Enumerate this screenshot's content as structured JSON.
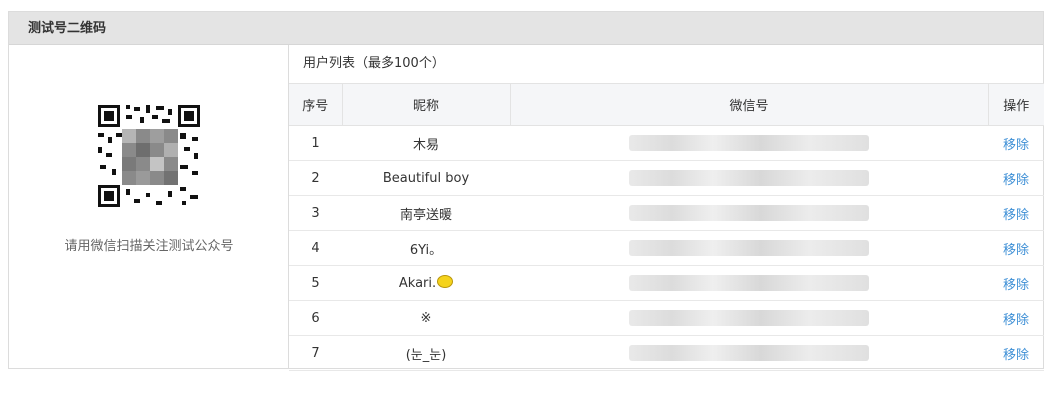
{
  "panel": {
    "title": "测试号二维码"
  },
  "qr": {
    "caption": "请用微信扫描关注测试公众号"
  },
  "users": {
    "title": "用户列表（最多100个）",
    "columns": {
      "no": "序号",
      "nickname": "昵称",
      "wechat_id": "微信号",
      "action": "操作"
    },
    "rows": [
      {
        "no": "1",
        "nickname": "木易",
        "action": "移除"
      },
      {
        "no": "2",
        "nickname": "Beautiful boy",
        "action": "移除"
      },
      {
        "no": "3",
        "nickname": "南亭送暖",
        "action": "移除"
      },
      {
        "no": "4",
        "nickname": "6Yi。",
        "action": "移除"
      },
      {
        "no": "5",
        "nickname": "Akari.",
        "nickname_icon": "lemon-emoji",
        "action": "移除"
      },
      {
        "no": "6",
        "nickname": "※",
        "action": "移除"
      },
      {
        "no": "7",
        "nickname": "(눈_눈)",
        "action": "移除"
      }
    ]
  },
  "colors": {
    "link": "#3d8fd6",
    "header_bg": "#e4e4e4",
    "table_header_bg": "#f5f6f8"
  }
}
